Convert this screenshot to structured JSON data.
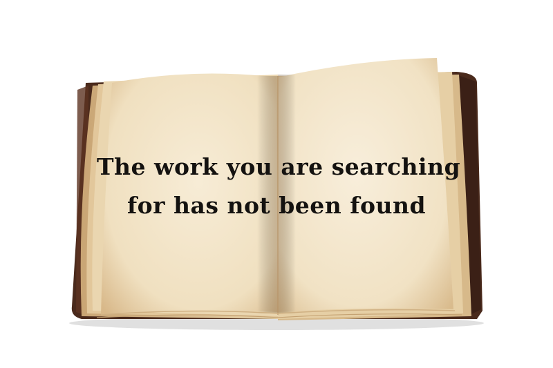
{
  "message": {
    "line1": "The work you are searching",
    "line2": "for has not been found"
  },
  "colors": {
    "background": "#ffffff",
    "page": "#f3e6cc",
    "page_edge": "#d9bf93",
    "cover": "#4a2a1c",
    "text": "#141210"
  }
}
